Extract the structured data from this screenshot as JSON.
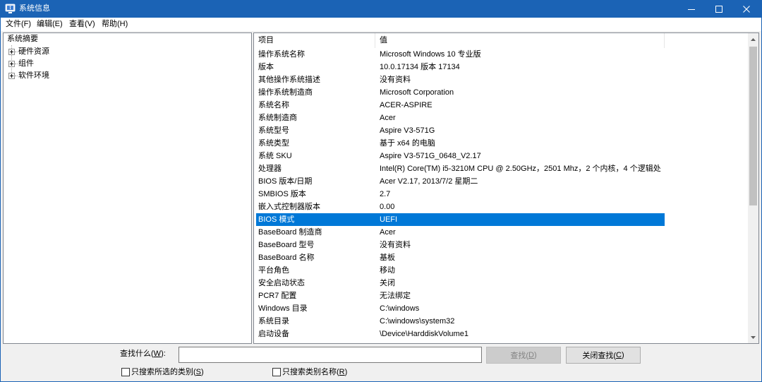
{
  "window": {
    "title": "系统信息"
  },
  "icons": {
    "app": "system-information-icon",
    "minimize": "minimize-icon",
    "maximize": "maximize-icon",
    "close": "close-icon",
    "tree_expander": "plus-box-icon",
    "scroll_up": "arrow-up-icon",
    "scroll_down": "arrow-down-icon"
  },
  "colors": {
    "title_bar": "#1b63b5",
    "selection": "#0078d7",
    "selection_text": "#ffffff"
  },
  "menu": [
    "文件(F)",
    "编辑(E)",
    "查看(V)",
    "帮助(H)"
  ],
  "tree": {
    "root": "系统摘要",
    "children": [
      {
        "label": "硬件资源",
        "expanded": false
      },
      {
        "label": "组件",
        "expanded": false
      },
      {
        "label": "软件环境",
        "expanded": false
      }
    ]
  },
  "list": {
    "columns": [
      "项目",
      "值"
    ],
    "rows": [
      {
        "item": "操作系统名称",
        "value": "Microsoft Windows 10 专业版"
      },
      {
        "item": "版本",
        "value": "10.0.17134 版本 17134"
      },
      {
        "item": "其他操作系统描述",
        "value": "没有资料"
      },
      {
        "item": "操作系统制造商",
        "value": "Microsoft Corporation"
      },
      {
        "item": "系统名称",
        "value": "ACER-ASPIRE"
      },
      {
        "item": "系统制造商",
        "value": "Acer"
      },
      {
        "item": "系统型号",
        "value": "Aspire V3-571G"
      },
      {
        "item": "系统类型",
        "value": "基于 x64 的电脑"
      },
      {
        "item": "系统 SKU",
        "value": "Aspire V3-571G_0648_V2.17"
      },
      {
        "item": "处理器",
        "value": "Intel(R) Core(TM) i5-3210M CPU @ 2.50GHz，2501 Mhz，2 个内核，4 个逻辑处"
      },
      {
        "item": "BIOS 版本/日期",
        "value": "Acer V2.17, 2013/7/2 星期二"
      },
      {
        "item": "SMBIOS 版本",
        "value": "2.7"
      },
      {
        "item": "嵌入式控制器版本",
        "value": "0.00"
      },
      {
        "item": "BIOS 模式",
        "value": "UEFI",
        "selected": true
      },
      {
        "item": "BaseBoard 制造商",
        "value": "Acer"
      },
      {
        "item": "BaseBoard 型号",
        "value": "没有资料"
      },
      {
        "item": "BaseBoard 名称",
        "value": "基板"
      },
      {
        "item": "平台角色",
        "value": "移动"
      },
      {
        "item": "安全启动状态",
        "value": "关闭"
      },
      {
        "item": "PCR7 配置",
        "value": "无法绑定"
      },
      {
        "item": "Windows 目录",
        "value": "C:\\windows"
      },
      {
        "item": "系统目录",
        "value": "C:\\windows\\system32"
      },
      {
        "item": "启动设备",
        "value": "\\Device\\HarddiskVolume1"
      }
    ]
  },
  "find_bar": {
    "label": {
      "text": "查找什么(",
      "key": "W",
      "after": "):"
    },
    "query": "",
    "find_button": {
      "text": "查找(",
      "key": "D",
      "after": ")",
      "enabled": false
    },
    "close_button": {
      "text": "关闭查找(",
      "key": "C",
      "after": ")"
    },
    "options": [
      {
        "text": "只搜索所选的类别(",
        "key": "S",
        "after": ")",
        "checked": false
      },
      {
        "text": "只搜索类别名称(",
        "key": "R",
        "after": ")",
        "checked": false
      }
    ]
  }
}
